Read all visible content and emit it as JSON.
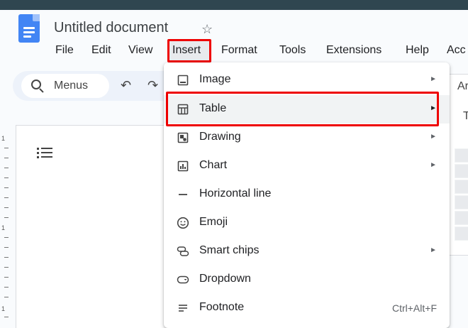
{
  "document": {
    "title": "Untitled document"
  },
  "menubar": {
    "items": [
      "File",
      "Edit",
      "View",
      "Insert",
      "Format",
      "Tools",
      "Extensions",
      "Help",
      "Acc"
    ]
  },
  "toolbar": {
    "search_label": "Menus"
  },
  "insert_menu": {
    "items": [
      {
        "label": "Image",
        "icon": "image-icon",
        "has_submenu": true
      },
      {
        "label": "Table",
        "icon": "table-icon",
        "has_submenu": true,
        "highlighted": true
      },
      {
        "label": "Drawing",
        "icon": "drawing-icon",
        "has_submenu": true
      },
      {
        "label": "Chart",
        "icon": "chart-icon",
        "has_submenu": true
      },
      {
        "label": "Horizontal line",
        "icon": "horizontal-line-icon",
        "has_submenu": false
      },
      {
        "label": "Emoji",
        "icon": "emoji-icon",
        "has_submenu": false
      },
      {
        "label": "Smart chips",
        "icon": "smart-chips-icon",
        "has_submenu": true
      },
      {
        "label": "Dropdown",
        "icon": "dropdown-icon",
        "has_submenu": false
      },
      {
        "label": "Footnote",
        "icon": "footnote-icon",
        "has_submenu": false,
        "shortcut": "Ctrl+Alt+F"
      }
    ]
  },
  "ruler": {
    "labels": [
      "1",
      "1",
      "1"
    ]
  },
  "right_panel": {
    "heading": "Ar",
    "letter": "T"
  },
  "colors": {
    "highlight_border": "#ee0000",
    "doc_blue": "#4285f4",
    "toolbar_bg": "#edf2fa"
  }
}
